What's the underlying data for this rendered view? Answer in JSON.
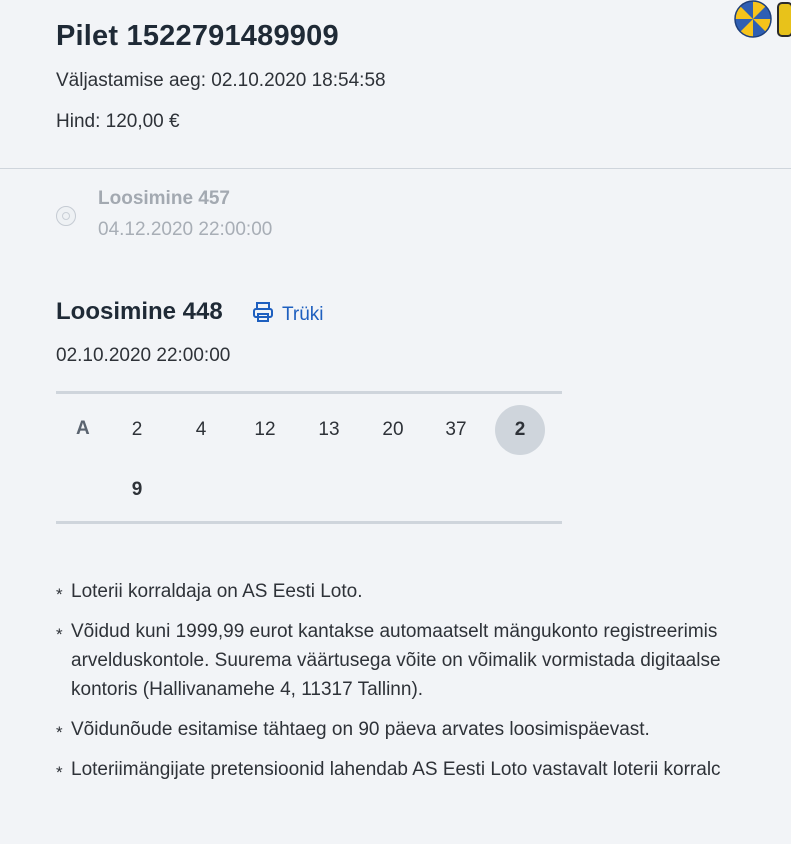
{
  "ticket": {
    "title": "Pilet 1522791489909",
    "issue_time": "Väljastamise aeg: 02.10.2020 18:54:58",
    "price": "Hind: 120,00 €",
    "logo_icon": "eesti-loto-logo"
  },
  "upcoming_draw": {
    "title": "Loosimine 457",
    "date": "04.12.2020 22:00:00"
  },
  "current_draw": {
    "title": "Loosimine 448",
    "print_label": "Trüki",
    "date": "02.10.2020 22:00:00",
    "row_label": "A",
    "numbers": [
      "2",
      "4",
      "12",
      "13",
      "20",
      "37"
    ],
    "bonus_number": "2",
    "extra_number": "9"
  },
  "notes": [
    {
      "lines": [
        "Loterii korraldaja on AS Eesti Loto."
      ]
    },
    {
      "lines": [
        "Võidud kuni 1999,99 eurot kantakse automaatselt mängukonto registreerimis",
        "arvelduskontole. Suurema väärtusega võite on võimalik vormistada digitaalse",
        "kontoris (Hallivanamehe 4, 11317 Tallinn)."
      ]
    },
    {
      "lines": [
        "Võidunõude esitamise tähtaeg on 90 päeva arvates loosimispäevast."
      ]
    },
    {
      "lines": [
        "Loteriimängijate pretensioonid lahendab AS Eesti Loto vastavalt loterii korralc"
      ]
    }
  ],
  "colors": {
    "background": "#f2f4f7",
    "link": "#1e5fbf",
    "muted": "#a3a9b1",
    "bonus_ball": "#cfd5dc"
  }
}
